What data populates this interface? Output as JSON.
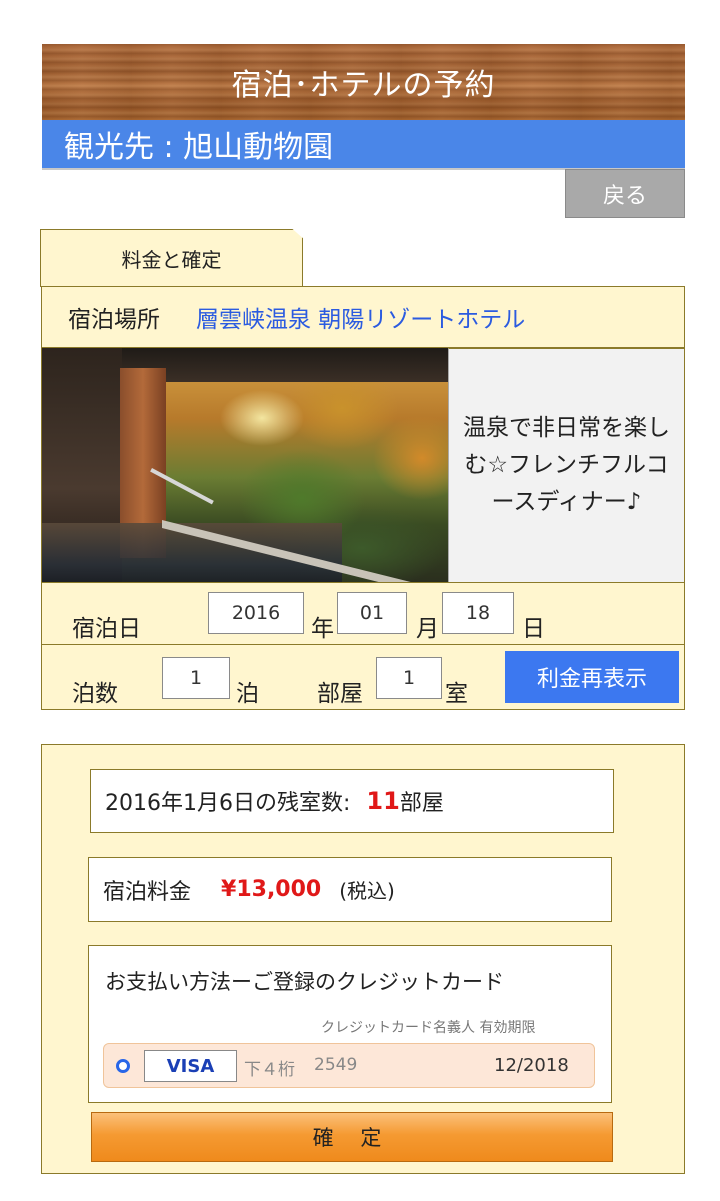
{
  "header": {
    "title": "宿泊･ホテルの予約"
  },
  "spot": {
    "label": "観光先 : 旭山動物園"
  },
  "back_button": "戻る",
  "tab": {
    "label": "料金と確定"
  },
  "hotel": {
    "label": "宿泊場所",
    "name": "層雲峡温泉 朝陽リゾートホテル"
  },
  "description": "温泉で非日常を楽しむ☆フレンチフルコースディナー♪",
  "date": {
    "label": "宿泊日",
    "year": "2016",
    "year_unit": "年",
    "month": "01",
    "month_unit": "月",
    "day": "18",
    "day_unit": "日"
  },
  "stay": {
    "nights_label": "泊数",
    "nights": "1",
    "nights_unit": "泊",
    "rooms_label": "部屋",
    "rooms": "1",
    "rooms_unit": "室",
    "recalc_button": "利金再表示"
  },
  "availability": {
    "prefix": "2016年1月6日の残室数:",
    "count": "11",
    "unit": "部屋"
  },
  "price": {
    "label": "宿泊料金",
    "amount": "¥13,000",
    "tax_note": "(税込)"
  },
  "payment": {
    "title": "お支払い方法ーご登録のクレジットカード",
    "subheader": "クレジットカード名義人 有効期限",
    "card_brand": "VISA",
    "last4_label": "下４桁",
    "last4": "2549",
    "expiry": "12/2018"
  },
  "confirm_button": "確 定",
  "colors": {
    "accent_blue": "#4a86e8",
    "price_red": "#e01818",
    "panel_bg": "#fff6cf",
    "confirm_orange": "#f59a32"
  }
}
